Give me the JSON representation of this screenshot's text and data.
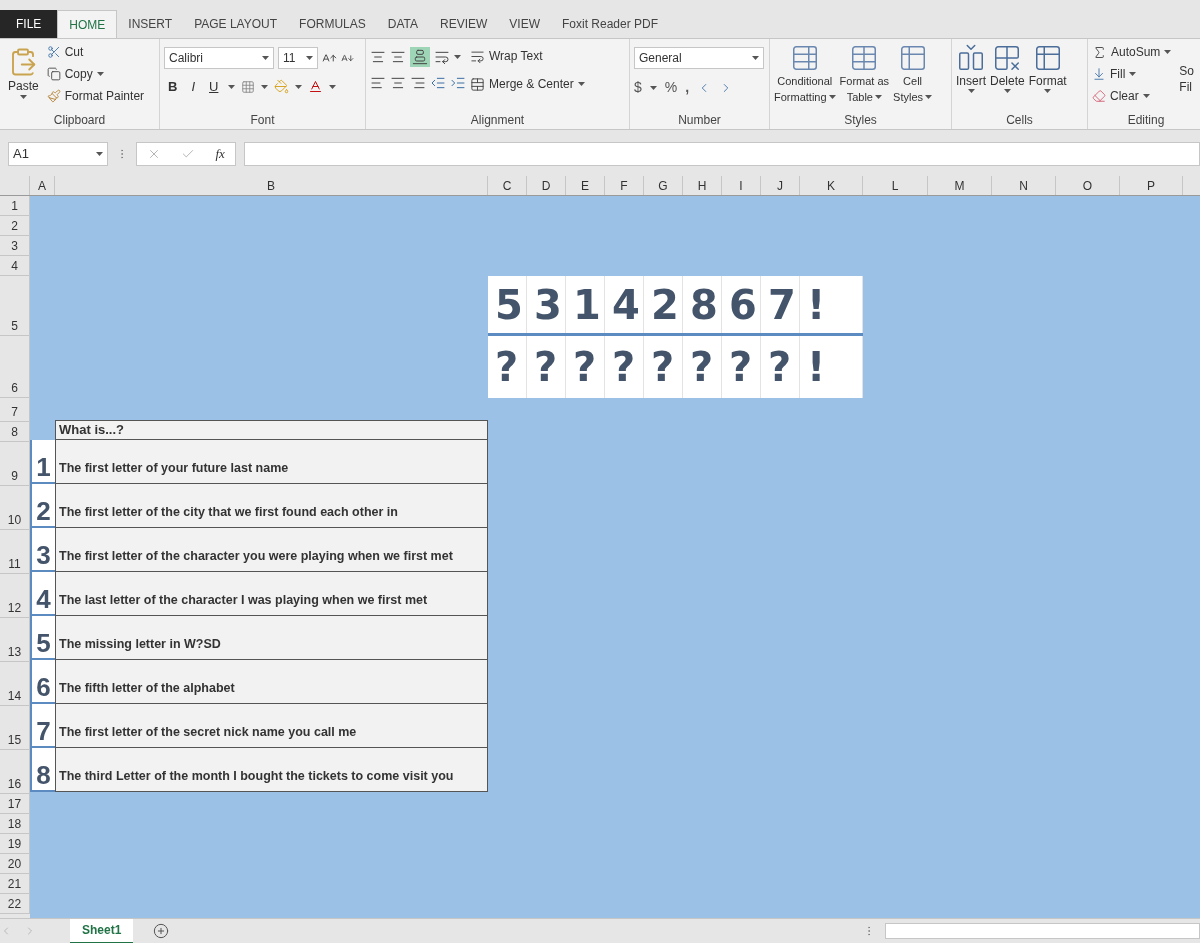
{
  "tabs": [
    {
      "label": "FILE",
      "kind": "file",
      "selected": false
    },
    {
      "label": "HOME",
      "kind": "tab",
      "selected": true
    },
    {
      "label": "INSERT",
      "kind": "tab",
      "selected": false
    },
    {
      "label": "PAGE LAYOUT",
      "kind": "tab",
      "selected": false
    },
    {
      "label": "FORMULAS",
      "kind": "tab",
      "selected": false
    },
    {
      "label": "DATA",
      "kind": "tab",
      "selected": false
    },
    {
      "label": "REVIEW",
      "kind": "tab",
      "selected": false
    },
    {
      "label": "VIEW",
      "kind": "tab",
      "selected": false
    },
    {
      "label": "Foxit Reader PDF",
      "kind": "tab",
      "selected": false
    }
  ],
  "clipboard": {
    "paste": "Paste",
    "cut": "Cut",
    "copy": "Copy",
    "format_painter": "Format Painter",
    "label": "Clipboard"
  },
  "font": {
    "name": "Calibri",
    "size": "11",
    "bold": "B",
    "italic": "I",
    "underline": "U",
    "label": "Font"
  },
  "alignment": {
    "wrap_text": "Wrap Text",
    "merge": "Merge & Center",
    "label": "Alignment"
  },
  "number": {
    "format": "General",
    "currency": "$",
    "percent": "%",
    "comma": ",",
    "label": "Number"
  },
  "styles": {
    "buttons": [
      {
        "line1": "Conditional",
        "line2": "Formatting"
      },
      {
        "line1": "Format as",
        "line2": "Table"
      },
      {
        "line1": "Cell",
        "line2": "Styles"
      }
    ],
    "label": "Styles"
  },
  "cells": {
    "buttons": [
      "Insert",
      "Delete",
      "Format"
    ],
    "label": "Cells"
  },
  "editing": {
    "autosum": "AutoSum",
    "fill": "Fill",
    "clear": "Clear",
    "sort_cut": "So",
    "sort_cut_2": "Fil",
    "label": "Editing"
  },
  "formula_bar": {
    "name_box": "A1",
    "function_symbol": "fx"
  },
  "columns": [
    "A",
    "B",
    "C",
    "D",
    "E",
    "F",
    "G",
    "H",
    "I",
    "J",
    "K",
    "L",
    "M",
    "N",
    "O",
    "P"
  ],
  "rows": [
    "1",
    "2",
    "3",
    "4",
    "5",
    "6",
    "7",
    "8",
    "9",
    "10",
    "11",
    "12",
    "13",
    "14",
    "15",
    "16",
    "17",
    "18",
    "19",
    "20",
    "21",
    "22"
  ],
  "puzzle": {
    "code": [
      "5",
      "3",
      "1",
      "4",
      "2",
      "8",
      "6",
      "7",
      "!"
    ],
    "answer": [
      "?",
      "?",
      "?",
      "?",
      "?",
      "?",
      "?",
      "?",
      "!"
    ]
  },
  "riddles": {
    "header": "What is...?",
    "items": [
      {
        "number": "1",
        "question": "The first letter of your future last name"
      },
      {
        "number": "2",
        "question": "The first letter of the city that we first found each other in"
      },
      {
        "number": "3",
        "question": "The first letter of the character you were playing when we first met"
      },
      {
        "number": "4",
        "question": "The last letter of the character I was playing when we first met"
      },
      {
        "number": "5",
        "question": "The missing letter in W?SD"
      },
      {
        "number": "6",
        "question": "The fifth letter of the alphabet"
      },
      {
        "number": "7",
        "question": "The first letter of the secret nick name you call me"
      },
      {
        "number": "8",
        "question": "The third Letter of the month I bought the tickets to come visit you"
      }
    ]
  },
  "sheet_tabs": [
    {
      "label": "Sheet1",
      "selected": true
    }
  ]
}
